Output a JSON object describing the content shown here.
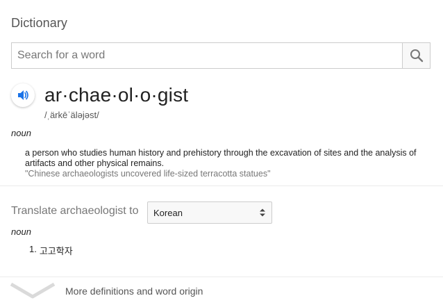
{
  "header": {
    "title": "Dictionary"
  },
  "search": {
    "placeholder": "Search for a word",
    "value": ""
  },
  "entry": {
    "word": "ar·chae·ol·o·gist",
    "phonetic": "/ˌärkēˈäləjəst/",
    "pos": "noun",
    "definition": "a person who studies human history and prehistory through the excavation of sites and the analysis of artifacts and other physical remains.",
    "example": "\"Chinese archaeologists uncovered life-sized terracotta statues\""
  },
  "translate": {
    "label": "Translate archaeologist to",
    "language": "Korean",
    "pos": "noun",
    "items": [
      {
        "num": "1.",
        "text": "고고학자"
      }
    ]
  },
  "footer": {
    "more_label": "More definitions and word origin"
  },
  "colors": {
    "accent": "#1a73e8",
    "muted": "#777777",
    "divider": "#ebebeb"
  }
}
